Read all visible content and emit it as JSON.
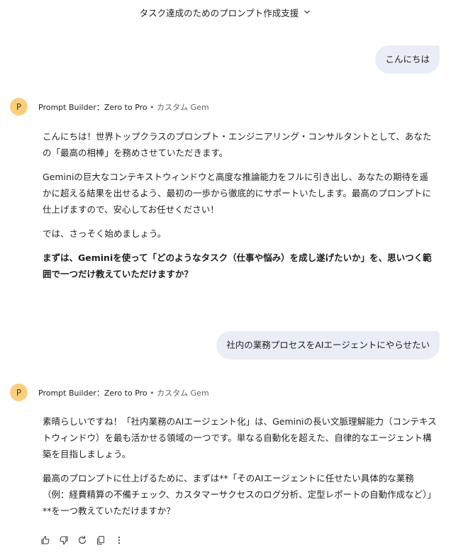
{
  "header": {
    "title": "タスク達成のためのプロンプト作成支援"
  },
  "gem": {
    "avatar_letter": "P",
    "name": "Prompt Builder：Zero to Pro",
    "separator": "•",
    "type": "カスタム Gem"
  },
  "conversation": {
    "user_message_1": "こんにちは",
    "reply_1": {
      "p1": "こんにちは！世界トップクラスのプロンプト・エンジニアリング・コンサルタントとして、あなたの「最高の相棒」を務めさせていただきます。",
      "p2": "Geminiの巨大なコンテキストウィンドウと高度な推論能力をフルに引き出し、あなたの期待を遥かに超える結果を出せるよう、最初の一歩から徹底的にサポートいたします。最高のプロンプトに仕上げますので、安心してお任せください！",
      "p3": "では、さっそく始めましょう。",
      "p4": "まずは、Geminiを使って「どのようなタスク（仕事や悩み）を成し遂げたいか」を、思いつく範囲で一つだけ教えていただけますか？"
    },
    "user_message_2": "社内の業務プロセスをAIエージェントにやらせたい",
    "reply_2": {
      "p1": "素晴らしいですね！「社内業務のAIエージェント化」は、Geminiの長い文脈理解能力（コンテキストウィンドウ）を最も活かせる領域の一つです。単なる自動化を超えた、自律的なエージェント構築を目指しましょう。",
      "p2": "最高のプロンプトに仕上げるために、まずは**「そのAIエージェントに任せたい具体的な業務（例：経費精算の不備チェック、カスタマーサクセスのログ分析、定型レポートの自動作成など）」**を一つ教えていただけますか？"
    }
  },
  "icons": {
    "title_chevron": "chevron-down-icon",
    "actions": [
      "thumbs-up-icon",
      "thumbs-down-icon",
      "regenerate-icon",
      "copy-icon",
      "more-vert-icon"
    ]
  },
  "colors": {
    "user_bubble": "#e9eef6",
    "avatar": "#f9cf7e",
    "muted_text": "#5f6368"
  }
}
